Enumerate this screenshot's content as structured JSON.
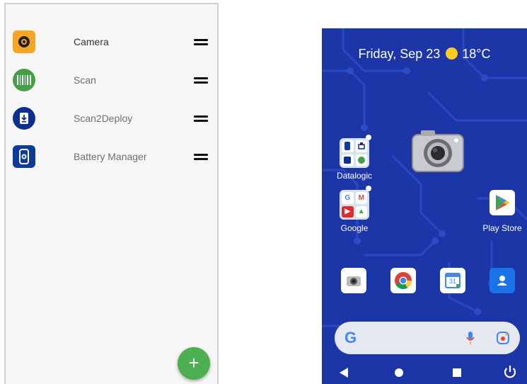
{
  "left_screen": {
    "apps": [
      {
        "label": "Camera",
        "icon": "camera-aperture-icon",
        "color": "#f5a623"
      },
      {
        "label": "Scan",
        "icon": "barcode-icon",
        "color": "#43a047"
      },
      {
        "label": "Scan2Deploy",
        "icon": "download-phone-icon",
        "color": "#0d2f8f"
      },
      {
        "label": "Battery Manager",
        "icon": "battery-phone-icon",
        "color": "#0d3a9c"
      }
    ],
    "fab_label": "+"
  },
  "right_screen": {
    "date": "Friday, Sep 23",
    "weather_icon": "sun-icon",
    "temperature": "18°C",
    "folders": [
      {
        "label": "Datalogic"
      },
      {
        "label": "Google",
        "cells": [
          "G",
          "M",
          "▶",
          "▲"
        ]
      }
    ],
    "play_store_label": "Play Store",
    "dock": [
      {
        "icon": "camera-icon"
      },
      {
        "icon": "chrome-icon"
      },
      {
        "icon": "calendar-icon",
        "text": "31"
      },
      {
        "icon": "contacts-icon"
      }
    ],
    "search_logo": "G",
    "nav": [
      "back-icon",
      "home-icon",
      "recents-icon",
      "power-icon"
    ],
    "colors": {
      "wallpaper": "#1c36a8",
      "fab": "#4caf50"
    }
  }
}
